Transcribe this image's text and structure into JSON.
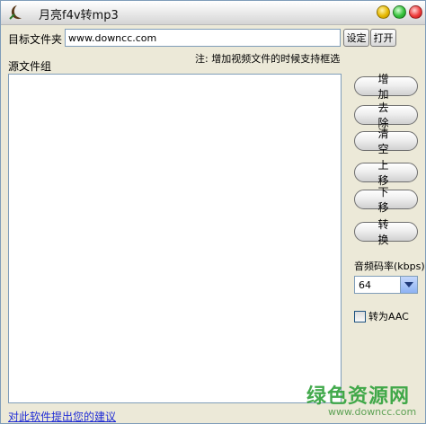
{
  "window": {
    "title": "月亮f4v转mp3"
  },
  "target": {
    "label": "目标文件夹",
    "value": "www.downcc.com",
    "set_label": "设定",
    "open_label": "打开"
  },
  "note": "注: 增加视频文件的时候支持框选",
  "source": {
    "label": "源文件组",
    "items": []
  },
  "actions": {
    "add": "增 加",
    "remove": "去 除",
    "clear": "清 空",
    "up": "上 移",
    "down": "下 移",
    "convert": "转 换"
  },
  "bitrate": {
    "label": "音频码率(kbps)",
    "selected": "64"
  },
  "aac": {
    "label": "转为AAC",
    "checked": false
  },
  "status": {
    "link": "对此软件提出您的建议"
  },
  "watermark": {
    "main": "绿色资源网",
    "sub": "www.downcc.com"
  },
  "colors": {
    "accent_link": "#1f2cd6",
    "watermark": "#2fa13a",
    "window_bg": "#ece9d8"
  }
}
